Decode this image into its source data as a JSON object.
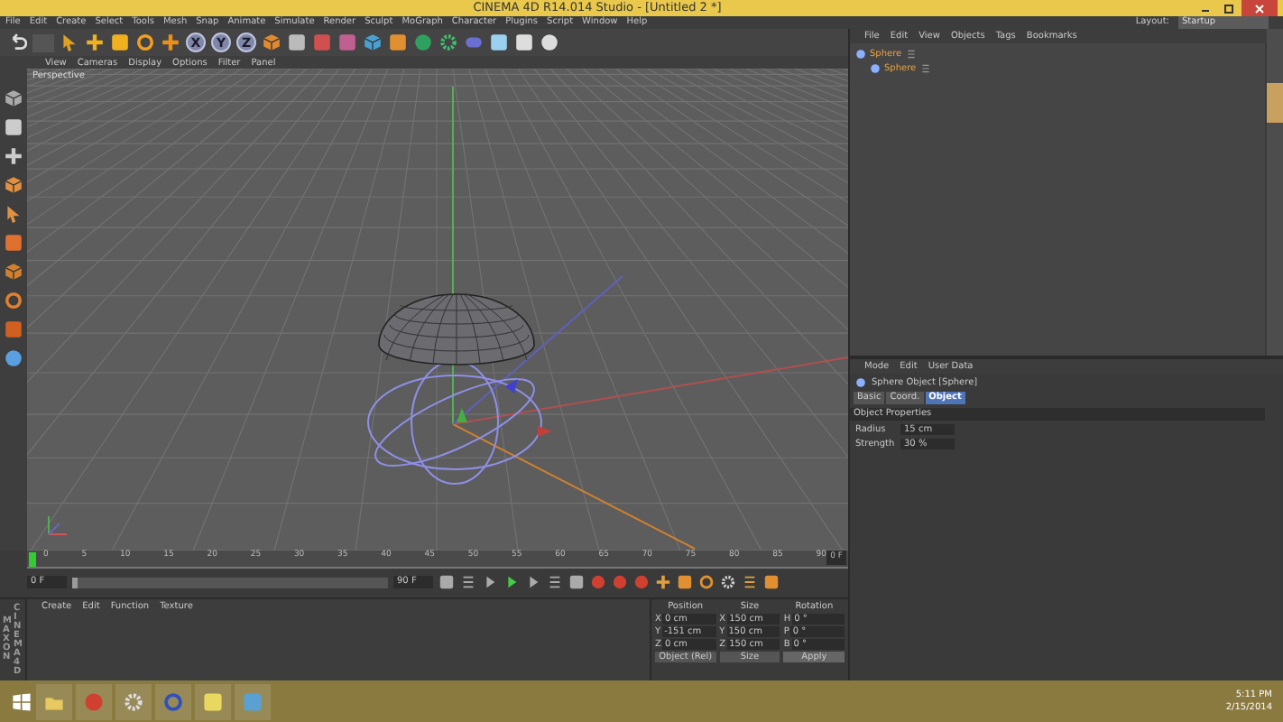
{
  "window": {
    "title": "CINEMA 4D R14.014 Studio - [Untitled 2 *]"
  },
  "menu_bar": {
    "items": [
      "File",
      "Edit",
      "Create",
      "Select",
      "Tools",
      "Mesh",
      "Snap",
      "Animate",
      "Simulate",
      "Render",
      "Sculpt",
      "MoGraph",
      "Character",
      "Plugins",
      "Script",
      "Window",
      "Help"
    ],
    "layout_label": "Layout:",
    "layout_value": "Startup"
  },
  "toolbar": {
    "axis_buttons": [
      "X",
      "Y",
      "Z"
    ]
  },
  "viewport": {
    "menu": [
      "View",
      "Cameras",
      "Display",
      "Options",
      "Filter",
      "Panel"
    ],
    "camera_label": "Perspective"
  },
  "object_manager": {
    "menu": [
      "File",
      "Edit",
      "View",
      "Objects",
      "Tags",
      "Bookmarks"
    ],
    "objects": [
      {
        "name": "Sphere",
        "children": [
          {
            "name": "Sphere"
          }
        ]
      }
    ]
  },
  "attribute_manager": {
    "menu": [
      "Mode",
      "Edit",
      "User Data"
    ],
    "object_title": "Sphere Object [Sphere]",
    "tabs": [
      {
        "label": "Basic",
        "selected": false
      },
      {
        "label": "Coord.",
        "selected": false
      },
      {
        "label": "Object",
        "selected": true
      }
    ],
    "section": "Object Properties",
    "fields": [
      {
        "label": "Radius",
        "value": "15 cm"
      },
      {
        "label": "Strength",
        "value": "30 %"
      }
    ]
  },
  "timeline": {
    "ticks": [
      "0",
      "5",
      "10",
      "15",
      "20",
      "25",
      "30",
      "35",
      "40",
      "45",
      "50",
      "55",
      "60",
      "65",
      "70",
      "75",
      "80",
      "85",
      "90"
    ],
    "current_frame": "0 F",
    "start_field": "0 F",
    "end_field": "90 F",
    "level": 0.0
  },
  "material_manager": {
    "menu": [
      "Create",
      "Edit",
      "Function",
      "Texture"
    ],
    "brand": [
      "MAXON",
      "CINEMA4D"
    ]
  },
  "coordinates": {
    "headers": [
      "Position",
      "Size",
      "Rotation"
    ],
    "rows": [
      {
        "axis": "X",
        "position": "0 cm",
        "size_axis": "X",
        "size": "150 cm",
        "rot_axis": "H",
        "rotation": "0 °"
      },
      {
        "axis": "Y",
        "position": "-151 cm",
        "size_axis": "Y",
        "size": "150 cm",
        "rot_axis": "P",
        "rotation": "0 °"
      },
      {
        "axis": "Z",
        "position": "0 cm",
        "size_axis": "Z",
        "size": "150 cm",
        "rot_axis": "B",
        "rotation": "0 °"
      }
    ],
    "mode": "Object (Rel)",
    "size_mode": "Size",
    "apply": "Apply"
  },
  "taskbar": {
    "time": "5:11 PM",
    "date": "2/15/2014"
  }
}
